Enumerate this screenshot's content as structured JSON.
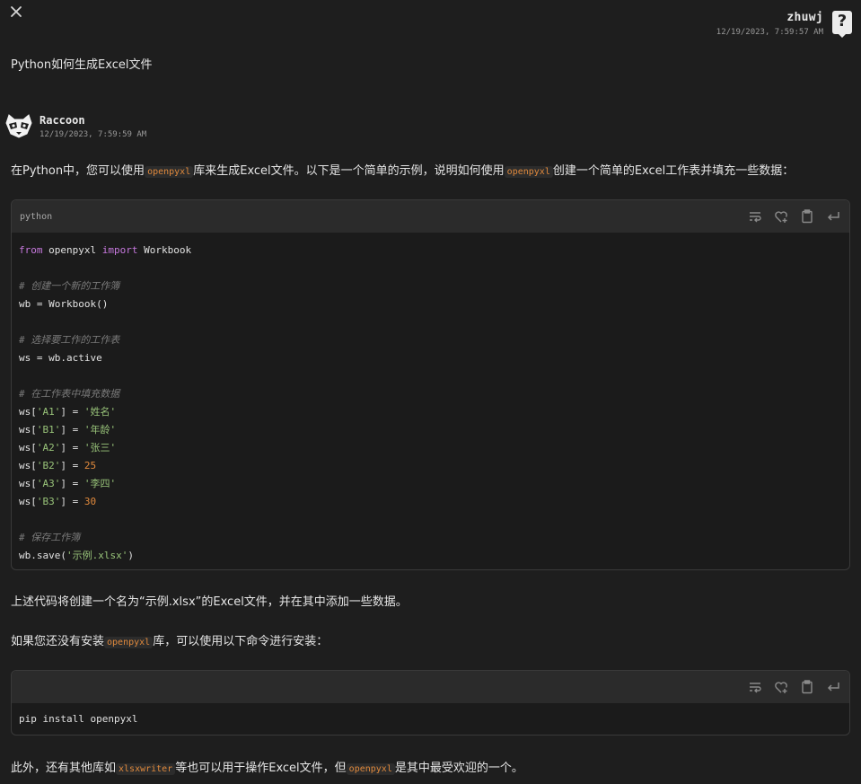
{
  "user": {
    "name": "zhuwj",
    "timestamp": "12/19/2023, 7:59:57 AM",
    "avatar_glyph": "?",
    "question": "Python如何生成Excel文件"
  },
  "bot": {
    "name": "Raccoon",
    "timestamp": "12/19/2023, 7:59:59 AM"
  },
  "intro": {
    "part1": "在Python中，您可以使用",
    "code1": "openpyxl",
    "part2": "库来生成Excel文件。以下是一个简单的示例，说明如何使用",
    "code2": "openpyxl",
    "part3": "创建一个简单的Excel工作表并填充一些数据："
  },
  "code_block_1": {
    "language": "python",
    "lines": {
      "l1_kw1": "from",
      "l1_mid": " openpyxl ",
      "l1_kw2": "import",
      "l1_end": " Workbook",
      "c1": "# 创建一个新的工作簿",
      "l2": "wb = Workbook()",
      "c2": "# 选择要工作的工作表",
      "l3": "ws = wb.active",
      "c3": "# 在工作表中填充数据",
      "a1_key": "'A1'",
      "a1_val": "'姓名'",
      "b1_key": "'B1'",
      "b1_val": "'年龄'",
      "a2_key": "'A2'",
      "a2_val": "'张三'",
      "b2_key": "'B2'",
      "b2_val": "25",
      "a3_key": "'A3'",
      "a3_val": "'李四'",
      "b3_key": "'B3'",
      "b3_val": "30",
      "c4": "# 保存工作簿",
      "save_pre": "wb.save(",
      "save_arg": "'示例.xlsx'",
      "save_post": ")"
    }
  },
  "after_code": "上述代码将创建一个名为“示例.xlsx”的Excel文件，并在其中添加一些数据。",
  "install_note": {
    "part1": "如果您还没有安装",
    "code": "openpyxl",
    "part2": "库，可以使用以下命令进行安装："
  },
  "code_block_2": {
    "language": "",
    "line": "pip install openpyxl"
  },
  "final_note": {
    "part1": "此外，还有其他库如",
    "code1": "xlsxwriter",
    "part2": "等也可以用于操作Excel文件，但",
    "code2": "openpyxl",
    "part3": "是其中最受欢迎的一个。"
  },
  "colors": {
    "background": "#1e1e1e",
    "code_header": "#2b2b2b",
    "inline_code": "#e0893c",
    "keyword": "#c678dd",
    "string": "#98c379",
    "comment": "#7a7a7a"
  },
  "icons": [
    "close-icon",
    "help-avatar-icon",
    "raccoon-icon",
    "wrap-icon",
    "like-icon",
    "clipboard-icon",
    "insert-icon"
  ]
}
